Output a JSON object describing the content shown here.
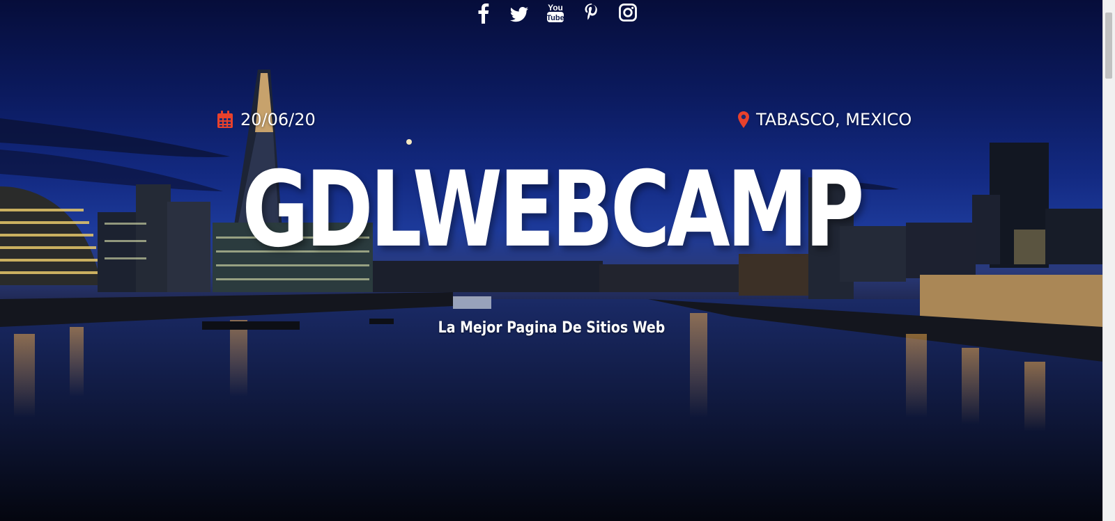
{
  "social": [
    {
      "name": "facebook-icon"
    },
    {
      "name": "twitter-icon"
    },
    {
      "name": "youtube-icon",
      "label_top": "You",
      "label_bottom": "Tube"
    },
    {
      "name": "pinterest-icon"
    },
    {
      "name": "instagram-icon"
    }
  ],
  "event": {
    "date": "20/06/20",
    "location": "TABASCO, MEXICO"
  },
  "hero": {
    "title": "GDLWEBCAMP",
    "subtitle": "La Mejor Pagina De Sitios Web"
  },
  "colors": {
    "accent": "#e8412c",
    "text": "#ffffff"
  }
}
